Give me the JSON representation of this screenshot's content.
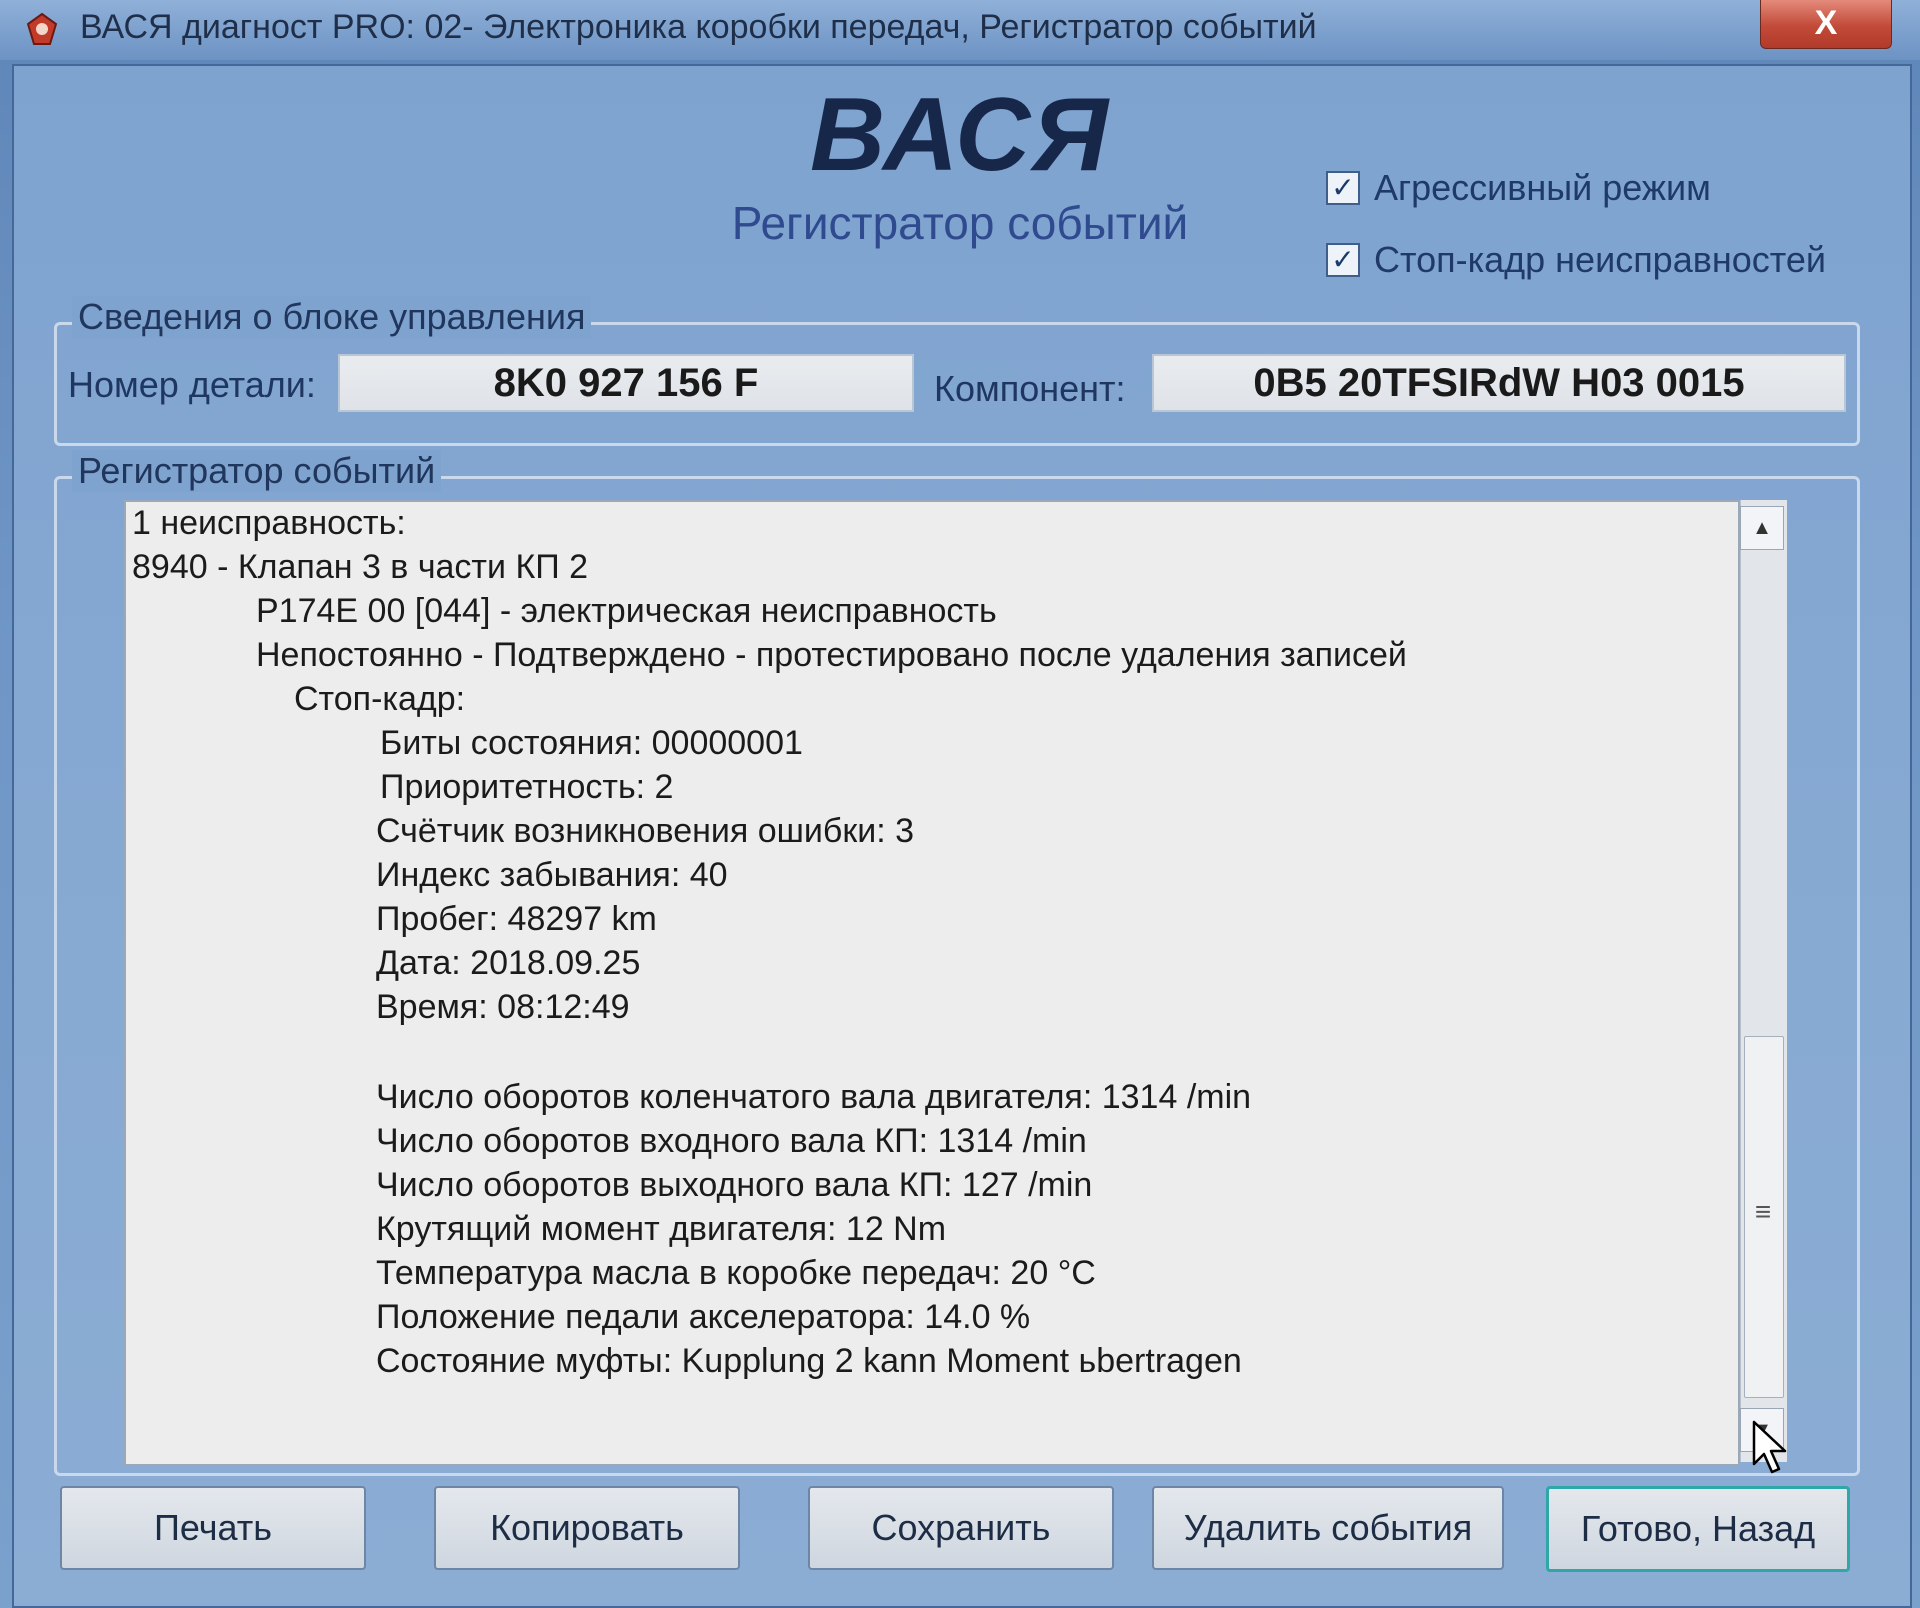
{
  "window": {
    "title": "ВАСЯ диагност PRO: 02- Электроника коробки передач,  Регистратор событий",
    "close_label": "X"
  },
  "header": {
    "logo_text": "ВАСЯ",
    "subtitle": "Регистратор событий"
  },
  "options": {
    "aggressive_mode": {
      "label": "Агрессивный режим",
      "checked": true
    },
    "freeze_frame": {
      "label": "Стоп-кадр неисправностей",
      "checked": true
    }
  },
  "control_unit": {
    "group_title": "Сведения о блоке управления",
    "part_number_label": "Номер детали:",
    "part_number": "8K0 927 156 F",
    "component_label": "Компонент:",
    "component": "0B5 20TFSIRdW H03 0015"
  },
  "event_log": {
    "group_title": "Регистратор событий",
    "lines": {
      "fault_count": "1 неисправность:",
      "fault_code": "8940 - Клапан 3 в части КП 2",
      "obd_code": "P174E 00 [044] - электрическая неисправность",
      "status": "Непостоянно - Подтверждено - протестировано после удаления записей",
      "freeze_frame": "Стоп-кадр:",
      "status_bits": "Биты состояния: 00000001",
      "priority": "Приоритетность: 2",
      "error_counter": "Счётчик возникновения ошибки: 3",
      "forget_index": "Индекс забывания: 40",
      "mileage": "Пробег: 48297 km",
      "date": "Дата: 2018.09.25",
      "time": "Время: 08:12:49",
      "engine_rpm": "Число оборотов коленчатого вала двигателя: 1314 /min",
      "input_shaft_rpm": "Число оборотов входного вала КП: 1314 /min",
      "output_shaft_rpm": "Число оборотов выходного вала КП: 127 /min",
      "engine_torque": "Крутящий момент двигателя: 12 Nm",
      "oil_temp": "Температура масла в коробке передач: 20 °C",
      "pedal_position": "Положение педали акселератора: 14.0 %",
      "clutch_state": "Состояние муфты: Kupplung 2 kann Moment ьbertragen"
    }
  },
  "buttons": {
    "print": "Печать",
    "copy": "Копировать",
    "save": "Сохранить",
    "delete_events": "Удалить события",
    "done_back": "Готово, Назад"
  },
  "colors": {
    "window_bg": "#7ea3cf",
    "close_button": "#c24a38",
    "default_button_border": "#2fa7a7"
  },
  "icons": {
    "app": "app-logo-icon",
    "check": "check-icon",
    "scroll_up": "triangle-up-icon",
    "scroll_down": "triangle-down-icon",
    "cursor": "mouse-pointer-icon"
  }
}
